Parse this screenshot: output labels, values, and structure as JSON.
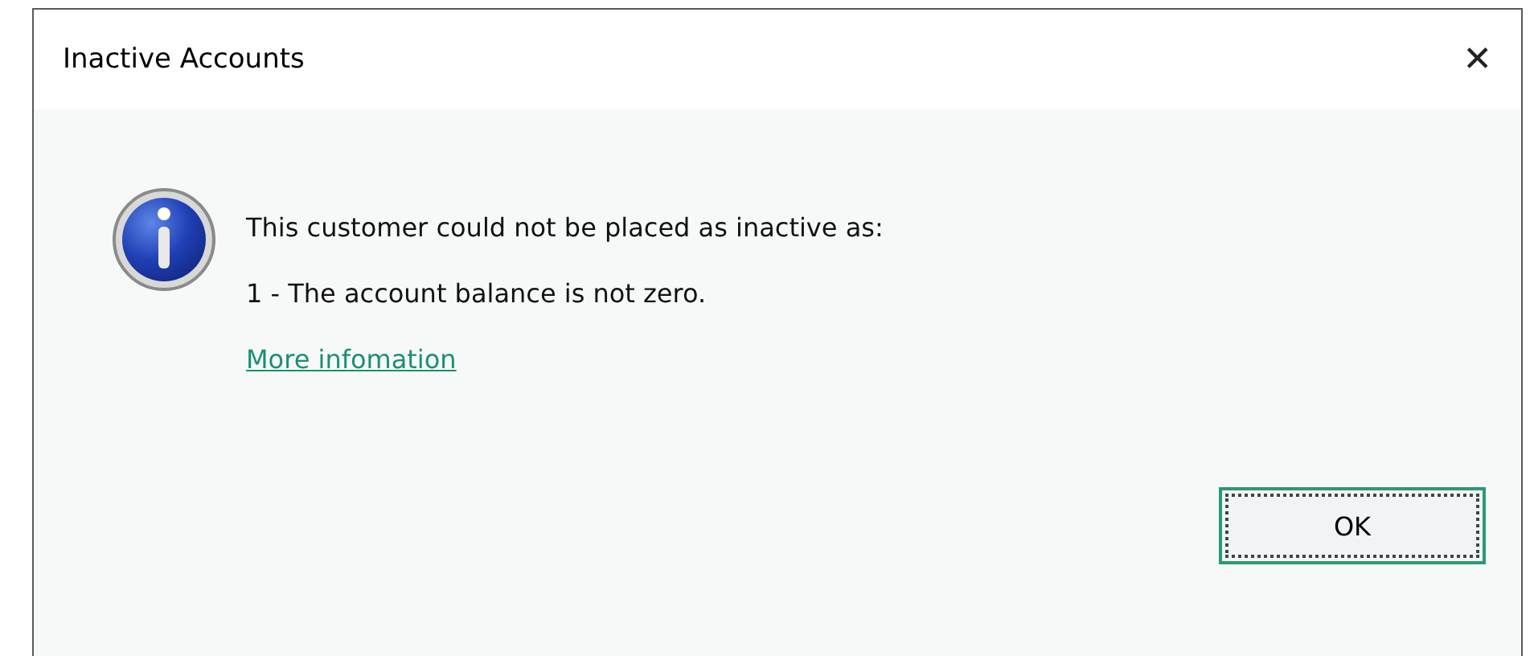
{
  "window": {
    "title": "Inactive Accounts",
    "close": "✕"
  },
  "message": {
    "lines": [
      "This customer could not be placed as inactive as:",
      "1 - The account balance is not zero."
    ],
    "link": "More infomation"
  },
  "buttons": [
    {
      "label": "OK",
      "focused": true
    }
  ]
}
